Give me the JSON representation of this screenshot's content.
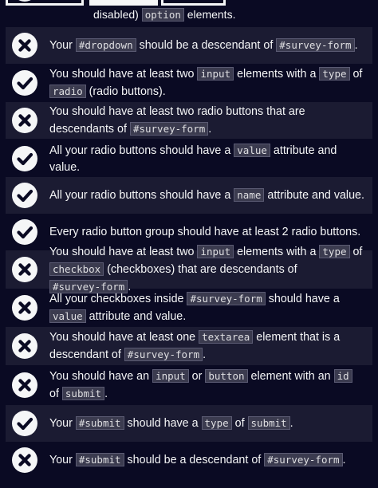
{
  "top_fragment": {
    "text_before": "disabled)",
    "code": "option",
    "text_after": "elements."
  },
  "items": [
    {
      "status": "fail",
      "parts": [
        {
          "t": "Your "
        },
        {
          "c": "#dropdown"
        },
        {
          "t": " should be a descendant of "
        },
        {
          "c": "#survey-form"
        },
        {
          "t": "."
        }
      ]
    },
    {
      "status": "pass",
      "parts": [
        {
          "t": "You should have at least two "
        },
        {
          "c": "input"
        },
        {
          "t": " elements with a "
        },
        {
          "c": "type"
        },
        {
          "t": " of "
        },
        {
          "c": "radio"
        },
        {
          "t": " (radio buttons)."
        }
      ]
    },
    {
      "status": "fail",
      "parts": [
        {
          "t": "You should have at least two radio buttons that are descendants of "
        },
        {
          "c": "#survey-form"
        },
        {
          "t": "."
        }
      ]
    },
    {
      "status": "pass",
      "parts": [
        {
          "t": "All your radio buttons should have a "
        },
        {
          "c": "value"
        },
        {
          "t": " attribute and value."
        }
      ]
    },
    {
      "status": "pass",
      "parts": [
        {
          "t": "All your radio buttons should have a "
        },
        {
          "c": "name"
        },
        {
          "t": " attribute and value."
        }
      ]
    },
    {
      "status": "pass",
      "parts": [
        {
          "t": "Every radio button group should have at least 2 radio buttons."
        }
      ]
    },
    {
      "status": "fail",
      "parts": [
        {
          "t": "You should have at least two "
        },
        {
          "c": "input"
        },
        {
          "t": " elements with a "
        },
        {
          "c": "type"
        },
        {
          "t": " of "
        },
        {
          "c": "checkbox"
        },
        {
          "t": " (checkboxes) that are descendants of "
        },
        {
          "c": "#survey-form"
        },
        {
          "t": "."
        }
      ]
    },
    {
      "status": "fail",
      "parts": [
        {
          "t": "All your checkboxes inside "
        },
        {
          "c": "#survey-form"
        },
        {
          "t": " should have a "
        },
        {
          "c": "value"
        },
        {
          "t": " attribute and value."
        }
      ]
    },
    {
      "status": "fail",
      "parts": [
        {
          "t": "You should have at least one "
        },
        {
          "c": "textarea"
        },
        {
          "t": " element that is a descendant of "
        },
        {
          "c": "#survey-form"
        },
        {
          "t": "."
        }
      ]
    },
    {
      "status": "fail",
      "parts": [
        {
          "t": "You should have an "
        },
        {
          "c": "input"
        },
        {
          "t": " or "
        },
        {
          "c": "button"
        },
        {
          "t": " element with an "
        },
        {
          "c": "id"
        },
        {
          "t": " of "
        },
        {
          "c": "submit"
        },
        {
          "t": "."
        }
      ]
    },
    {
      "status": "pass",
      "parts": [
        {
          "t": "Your "
        },
        {
          "c": "#submit"
        },
        {
          "t": " should have a "
        },
        {
          "c": "type"
        },
        {
          "t": " of "
        },
        {
          "c": "submit"
        },
        {
          "t": "."
        }
      ]
    },
    {
      "status": "fail",
      "parts": [
        {
          "t": "Your "
        },
        {
          "c": "#submit"
        },
        {
          "t": " should be a descendant of "
        },
        {
          "c": "#survey-form"
        },
        {
          "t": "."
        }
      ]
    }
  ],
  "icons": {
    "pass": "check-circle-icon",
    "fail": "x-circle-icon"
  },
  "colors": {
    "background": "#0a0a23",
    "row_shade": "#1b1b32",
    "text": "#f5f6f7",
    "code_bg": "#3b3b4f"
  }
}
